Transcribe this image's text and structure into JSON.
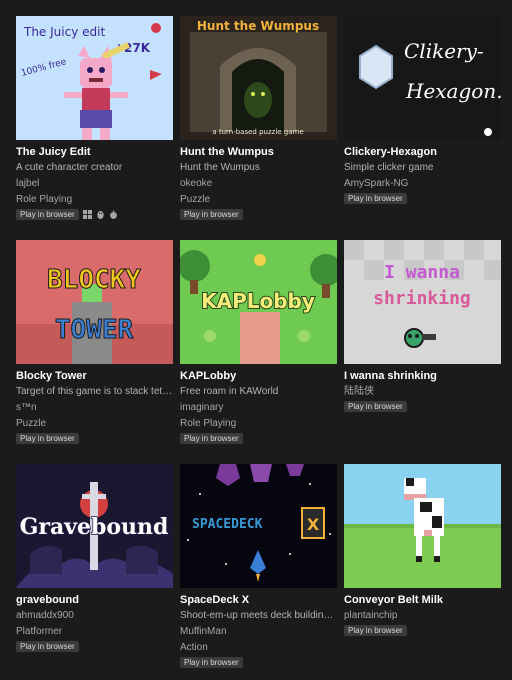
{
  "games": [
    {
      "title": "The Juicy Edit",
      "description": "A cute character creator",
      "author": "lajbel",
      "genre": "Role Playing",
      "badge": "Play in browser",
      "platforms": [
        "windows-icon",
        "linux-icon",
        "apple-icon"
      ],
      "cover": {
        "heading": "The Juicy edit",
        "count": "+27K",
        "stamp": "100% free"
      }
    },
    {
      "title": "Hunt the Wumpus",
      "description": "Hunt the Wumpus",
      "author": "okeoke",
      "genre": "Puzzle",
      "badge": "Play in browser",
      "cover": {
        "heading": "Hunt the Wumpus",
        "caption": "a turn-based puzzle game"
      }
    },
    {
      "title": "Clickery-Hexagon",
      "description": "Simple clicker game",
      "author": "AmySpark-NG",
      "genre": "",
      "badge": "Play in browser",
      "cover": {
        "line1": "Clikery-",
        "line2": "Hexagon."
      }
    },
    {
      "title": "Blocky Tower",
      "description": "Target of this game is to stack tetris blocks as high as possible",
      "author": "s™n",
      "genre": "Puzzle",
      "badge": "Play in browser",
      "cover": {
        "line1": "BLOCKY",
        "line2": "TOWER"
      }
    },
    {
      "title": "KAPLobby",
      "description": "Free roam in KAWorld",
      "author": "imaginary",
      "genre": "Role Playing",
      "badge": "Play in browser",
      "cover": {
        "heading": "KAPLobby"
      }
    },
    {
      "title": "I wanna shrinking",
      "description": "",
      "author": "陆陆侠",
      "genre": "",
      "badge": "Play in browser",
      "cover": {
        "line1": "I wanna",
        "line2": "shrinking"
      }
    },
    {
      "title": "gravebound",
      "description": "",
      "author": "ahmaddx900",
      "genre": "Platformer",
      "badge": "Play in browser",
      "cover": {
        "heading": "Gravebound"
      }
    },
    {
      "title": "SpaceDeck X",
      "description": "Shoot-em-up meets deck building, cards shape your ship",
      "author": "MuffinMan",
      "genre": "Action",
      "badge": "Play in browser",
      "cover": {
        "heading": "SPACEDECK",
        "mark": "X"
      }
    },
    {
      "title": "Conveyor Belt Milk",
      "description": "",
      "author": "plantainchip",
      "genre": "",
      "badge": "Play in browser",
      "cover": {}
    }
  ],
  "colors": {
    "background": "#1b1b1c",
    "title": "#ffffff",
    "meta": "#a6a6a8",
    "badge_bg": "#3a3a3d"
  }
}
